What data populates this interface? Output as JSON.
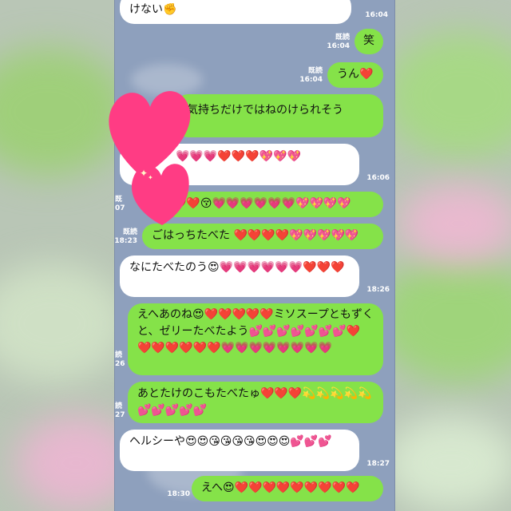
{
  "messages": [
    {
      "dir": "in",
      "text": "けない✊",
      "time": "16:04"
    },
    {
      "dir": "out",
      "text": "笑",
      "read": "既読",
      "time": "16:04"
    },
    {
      "dir": "out",
      "text": "うん❤️",
      "read": "既読",
      "time": "16:04"
    },
    {
      "dir": "out",
      "text": "気持ちだけではねのけられそう"
    },
    {
      "dir": "in",
      "text": "💗💗💗❤️❤️❤️💖💖💖",
      "time": "16:06"
    },
    {
      "dir": "out",
      "text": "❤️❤️😚💗💗💗💗💗💗💖💖💖💖",
      "read": "既",
      "time": "07"
    },
    {
      "dir": "out",
      "text": "ごはっちたべた ❤️❤️❤️❤️💖💖💖💖💖",
      "read": "既読",
      "time": "18:23"
    },
    {
      "dir": "in",
      "text": "なにたべたのう😍💗💗💗💗💗💗❤️❤️❤️",
      "time": "18:26"
    },
    {
      "dir": "out",
      "text": "えへあのね😍❤️❤️❤️❤️❤️ミソスープともずくと、ゼリーたべたよう💕💕💕💕💕💕💕❤️❤️❤️❤️❤️❤️❤️💗💗💗💗💗💗💗💗",
      "read": "読",
      "time": "26"
    },
    {
      "dir": "out",
      "text": "あとたけのこもたべたゅ❤️❤️❤️💫💫💫💫💫💕💕💕💕💕",
      "read": "読",
      "time": "27"
    },
    {
      "dir": "in",
      "text": "ヘルシーや😍😍😘😘😘😘😍😍😍💕💕💕",
      "time": "18:27"
    },
    {
      "dir": "out",
      "text": "えへ😍❤️❤️❤️❤️❤️❤️❤️❤️❤️",
      "time": "18:30"
    }
  ]
}
